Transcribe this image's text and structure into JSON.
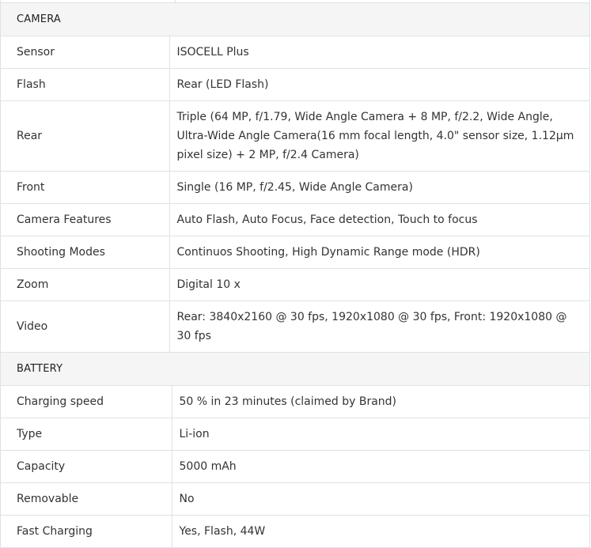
{
  "camera": {
    "heading": "CAMERA",
    "rows": [
      {
        "label": "Sensor",
        "value": "ISOCELL Plus"
      },
      {
        "label": "Flash",
        "value": "Rear (LED Flash)"
      },
      {
        "label": "Rear",
        "value": "Triple (64 MP, f/1.79, Wide Angle Camera + 8 MP, f/2.2, Wide Angle, Ultra-Wide Angle Camera(16 mm focal length, 4.0\" sensor size, 1.12µm pixel size) + 2 MP, f/2.4 Camera)"
      },
      {
        "label": "Front",
        "value": "Single (16 MP, f/2.45, Wide Angle Camera)"
      },
      {
        "label": "Camera Features",
        "value": "Auto Flash, Auto Focus, Face detection, Touch to focus"
      },
      {
        "label": "Shooting Modes",
        "value": "Continuos Shooting, High Dynamic Range mode (HDR)"
      },
      {
        "label": "Zoom",
        "value": "Digital 10 x"
      },
      {
        "label": "Video",
        "value": "Rear: 3840x2160 @ 30 fps, 1920x1080 @ 30 fps, Front: 1920x1080 @ 30 fps"
      }
    ]
  },
  "battery": {
    "heading": "BATTERY",
    "rows": [
      {
        "label": "Charging speed",
        "value": "50 % in 23 minutes (claimed by Brand)"
      },
      {
        "label": "Type",
        "value": "Li-ion"
      },
      {
        "label": "Capacity",
        "value": "5000 mAh"
      },
      {
        "label": "Removable",
        "value": "No"
      },
      {
        "label": "Fast Charging",
        "value": "Yes, Flash, 44W"
      }
    ]
  }
}
